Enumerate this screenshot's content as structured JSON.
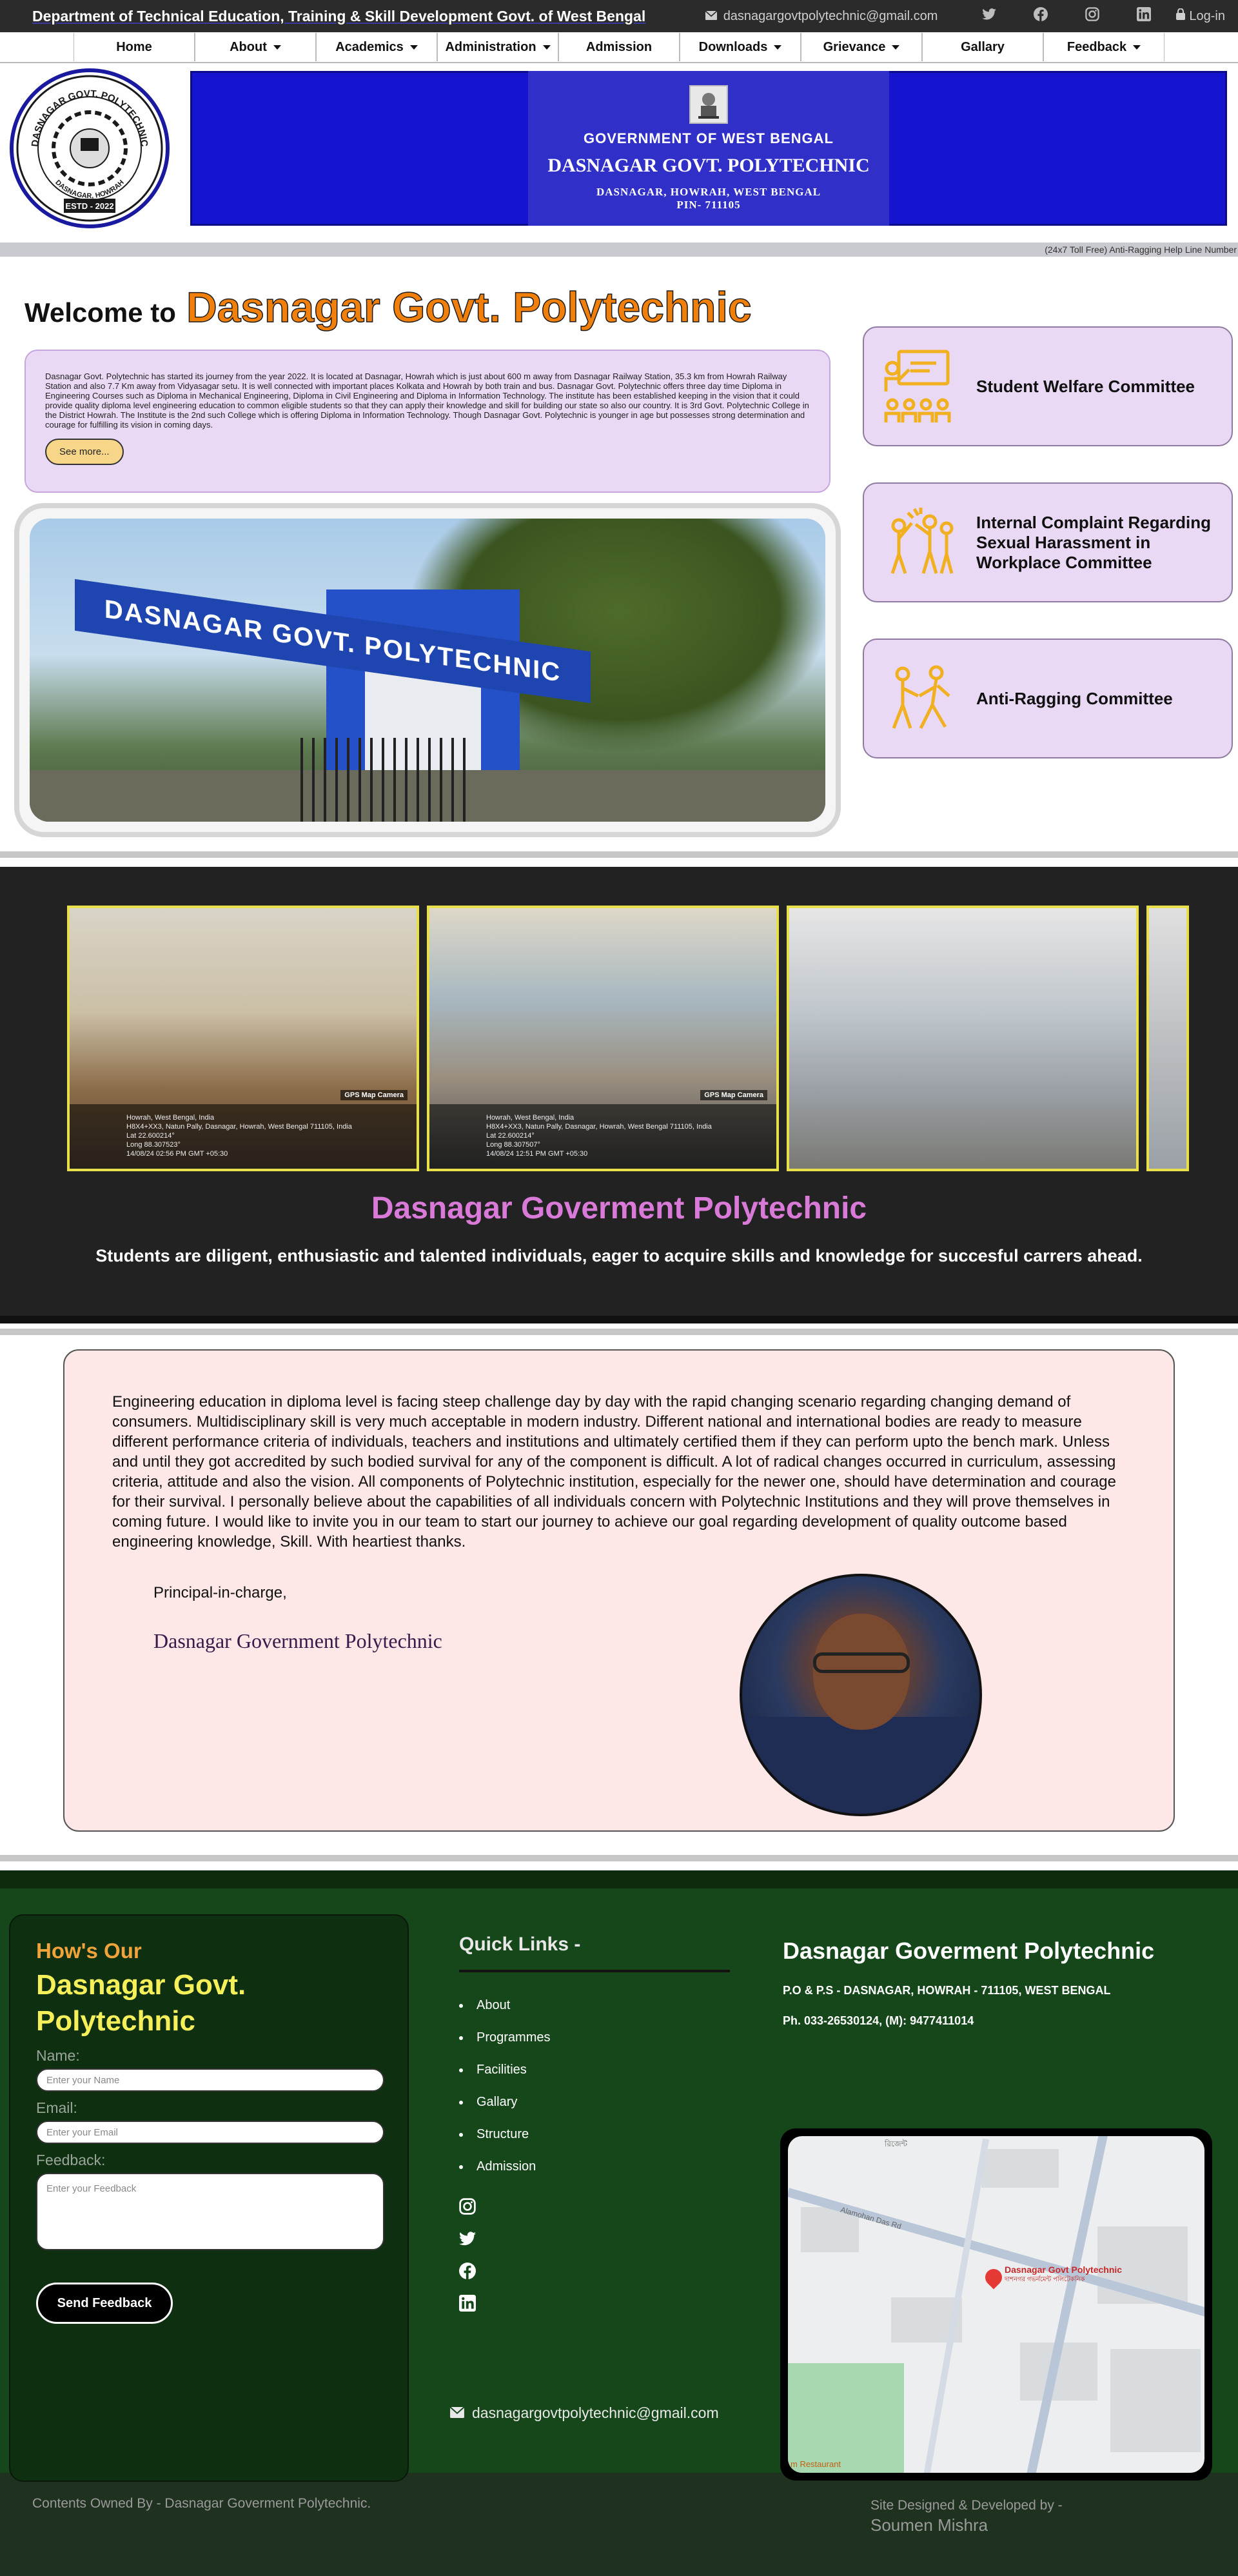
{
  "topbar": {
    "department": "Department of Technical Education, Training & Skill Development Govt. of West Bengal",
    "email": "dasnagargovtpolytechnic@gmail.com",
    "social": [
      "twitter-icon",
      "facebook-icon",
      "instagram-icon",
      "linkedin-icon"
    ],
    "login": "Log-in"
  },
  "nav": {
    "items": [
      {
        "label": "Home",
        "dropdown": false
      },
      {
        "label": "About",
        "dropdown": true
      },
      {
        "label": "Academics",
        "dropdown": true
      },
      {
        "label": "Administration",
        "dropdown": true
      },
      {
        "label": "Admission",
        "dropdown": false
      },
      {
        "label": "Downloads",
        "dropdown": true
      },
      {
        "label": "Grievance",
        "dropdown": true
      },
      {
        "label": "Gallary",
        "dropdown": false
      },
      {
        "label": "Feedback",
        "dropdown": true
      }
    ]
  },
  "header": {
    "logo_text_top": "DASNAGAR GOVT. POLYTECHNIC",
    "logo_text_bottom": "ESTD - 2022",
    "logo_text_place": "DASNAGAR, HOWRAH",
    "banner_line1": "GOVERNMENT OF WEST BENGAL",
    "banner_line2": "DASNAGAR GOVT. POLYTECHNIC",
    "banner_line3": "DASNAGAR, HOWRAH, WEST BENGAL",
    "banner_line4": "PIN- 711105"
  },
  "marquee": "(24x7 Toll Free) Anti-Ragging Help Line Number",
  "welcome": {
    "prefix": "Welcome to",
    "name": "Dasnagar Govt. Polytechnic",
    "intro": "Dasnagar Govt. Polytechnic has started its journey from the year 2022. It is located at Dasnagar, Howrah which is just about 600 m away from Dasnagar Railway Station, 35.3 km from Howrah Railway Station and also 7.7 Km away from Vidyasagar setu. It is well connected with important places Kolkata and Howrah by both train and bus. Dasnagar Govt. Polytechnic offers three day time Diploma in Engineering Courses such as Diploma in Mechanical Engineering, Diploma in Civil Engineering and Diploma in Information Technology. The institute has been established keeping in the vision that it could provide quality diploma level engineering education to common eligible students so that they can apply their knowledge and skill for building our state so also our country. It is 3rd Govt. Polytechnic College in the District Howrah. The Institute is the 2nd such College which is offering Diploma in Information Technology. Though Dasnagar Govt. Polytechnic is younger in age but possesses strong determination and courage for fulfilling its vision in coming days.",
    "see_more": "See more...",
    "gate_sign": "DASNAGAR GOVT. POLYTECHNIC"
  },
  "committees": [
    {
      "label": "Student Welfare Committee",
      "icon": "teacher-class-icon"
    },
    {
      "label": "Internal Complaint Regarding Sexual Harassment in Workplace Committee",
      "icon": "harassment-icon"
    },
    {
      "label": "Anti-Ragging Committee",
      "icon": "anti-ragging-icon"
    }
  ],
  "gallery": {
    "photos": [
      {
        "location": "Howrah, West Bengal, India",
        "address": "H8X4+XX3, Natun Pally, Dasnagar, Howrah, West Bengal 711105, India",
        "lat": "Lat 22.600214°",
        "long": "Long 88.307523°",
        "time": "14/08/24 02:56 PM GMT +05:30",
        "tag": "GPS Map Camera"
      },
      {
        "location": "Howrah, West Bengal, India",
        "address": "H8X4+XX3, Natun Pally, Dasnagar, Howrah, West Bengal 711105, India",
        "lat": "Lat 22.600214°",
        "long": "Long 88.307507°",
        "time": "14/08/24 12:51 PM GMT +05:30",
        "tag": "GPS Map Camera"
      },
      {
        "location": "",
        "address": "",
        "lat": "",
        "long": "",
        "time": "",
        "tag": ""
      }
    ],
    "title": "Dasnagar Goverment Polytechnic",
    "subtitle": "Students are diligent, enthusiastic and talented individuals, eager to acquire skills and knowledge for succesful carrers ahead."
  },
  "principal": {
    "message": "Engineering education in diploma level is facing steep challenge day by day with the rapid changing scenario regarding changing demand of consumers. Multidisciplinary skill is very much acceptable in modern industry. Different national and international bodies are ready to measure different performance criteria of individuals, teachers and institutions and ultimately certified them if they can perform upto the bench mark. Unless and until they got accredited by such bodied survival for any of the component is difficult. A lot of radical changes occurred in curriculum, assessing criteria, attitude and also the vision. All components of Polytechnic institution, especially for the newer one, should have determination and courage for their survival. I personally believe about the capabilities of all individuals concern with Polytechnic Institutions and they will prove themselves in coming future. I would like to invite you in our team to start our journey to achieve our goal regarding development of quality outcome based engineering knowledge, Skill. With heartiest thanks.",
    "role": "Principal-in-charge,",
    "institution": "Dasnagar Government Polytechnic"
  },
  "footer": {
    "feedback": {
      "heading1": "How's Our",
      "heading2": "Dasnagar Govt. Polytechnic",
      "name_label": "Name:",
      "name_placeholder": "Enter your Name",
      "email_label": "Email:",
      "email_placeholder": "Enter your Email",
      "feedback_label": "Feedback:",
      "feedback_placeholder": "Enter your Feedback",
      "send": "Send Feedback"
    },
    "quick_links": {
      "title": "Quick Links -",
      "items": [
        "About",
        "Programmes",
        "Facilities",
        "Gallary",
        "Structure",
        "Admission"
      ]
    },
    "email": "dasnagargovtpolytechnic@gmail.com",
    "address": {
      "title": "Dasnagar Goverment Polytechnic",
      "line1": "P.O & P.S - DASNAGAR, HOWRAH - 711105, WEST BENGAL",
      "line2": "Ph. 033-26530124, (M): 9477411014"
    },
    "map": {
      "pin_label": "Dasnagar Govt Polytechnic",
      "pin_label_local": "দাশনগর গভর্নমেন্ট পলিটেকনিক",
      "street": "Alamohan Das Rd",
      "place": "রিজেন্ট",
      "restaurant": "m Restaurant"
    },
    "owned": "Contents Owned By - Dasnagar Goverment Polytechnic.",
    "designed_label": "Site Designed & Developed by -",
    "designer": "Soumen Mishra"
  },
  "colors": {
    "accent_orange": "#f07f0c",
    "banner_blue": "#1515d0",
    "footer_green": "#15471b",
    "lavender": "#ead9f5",
    "pink": "#fde7e7"
  }
}
